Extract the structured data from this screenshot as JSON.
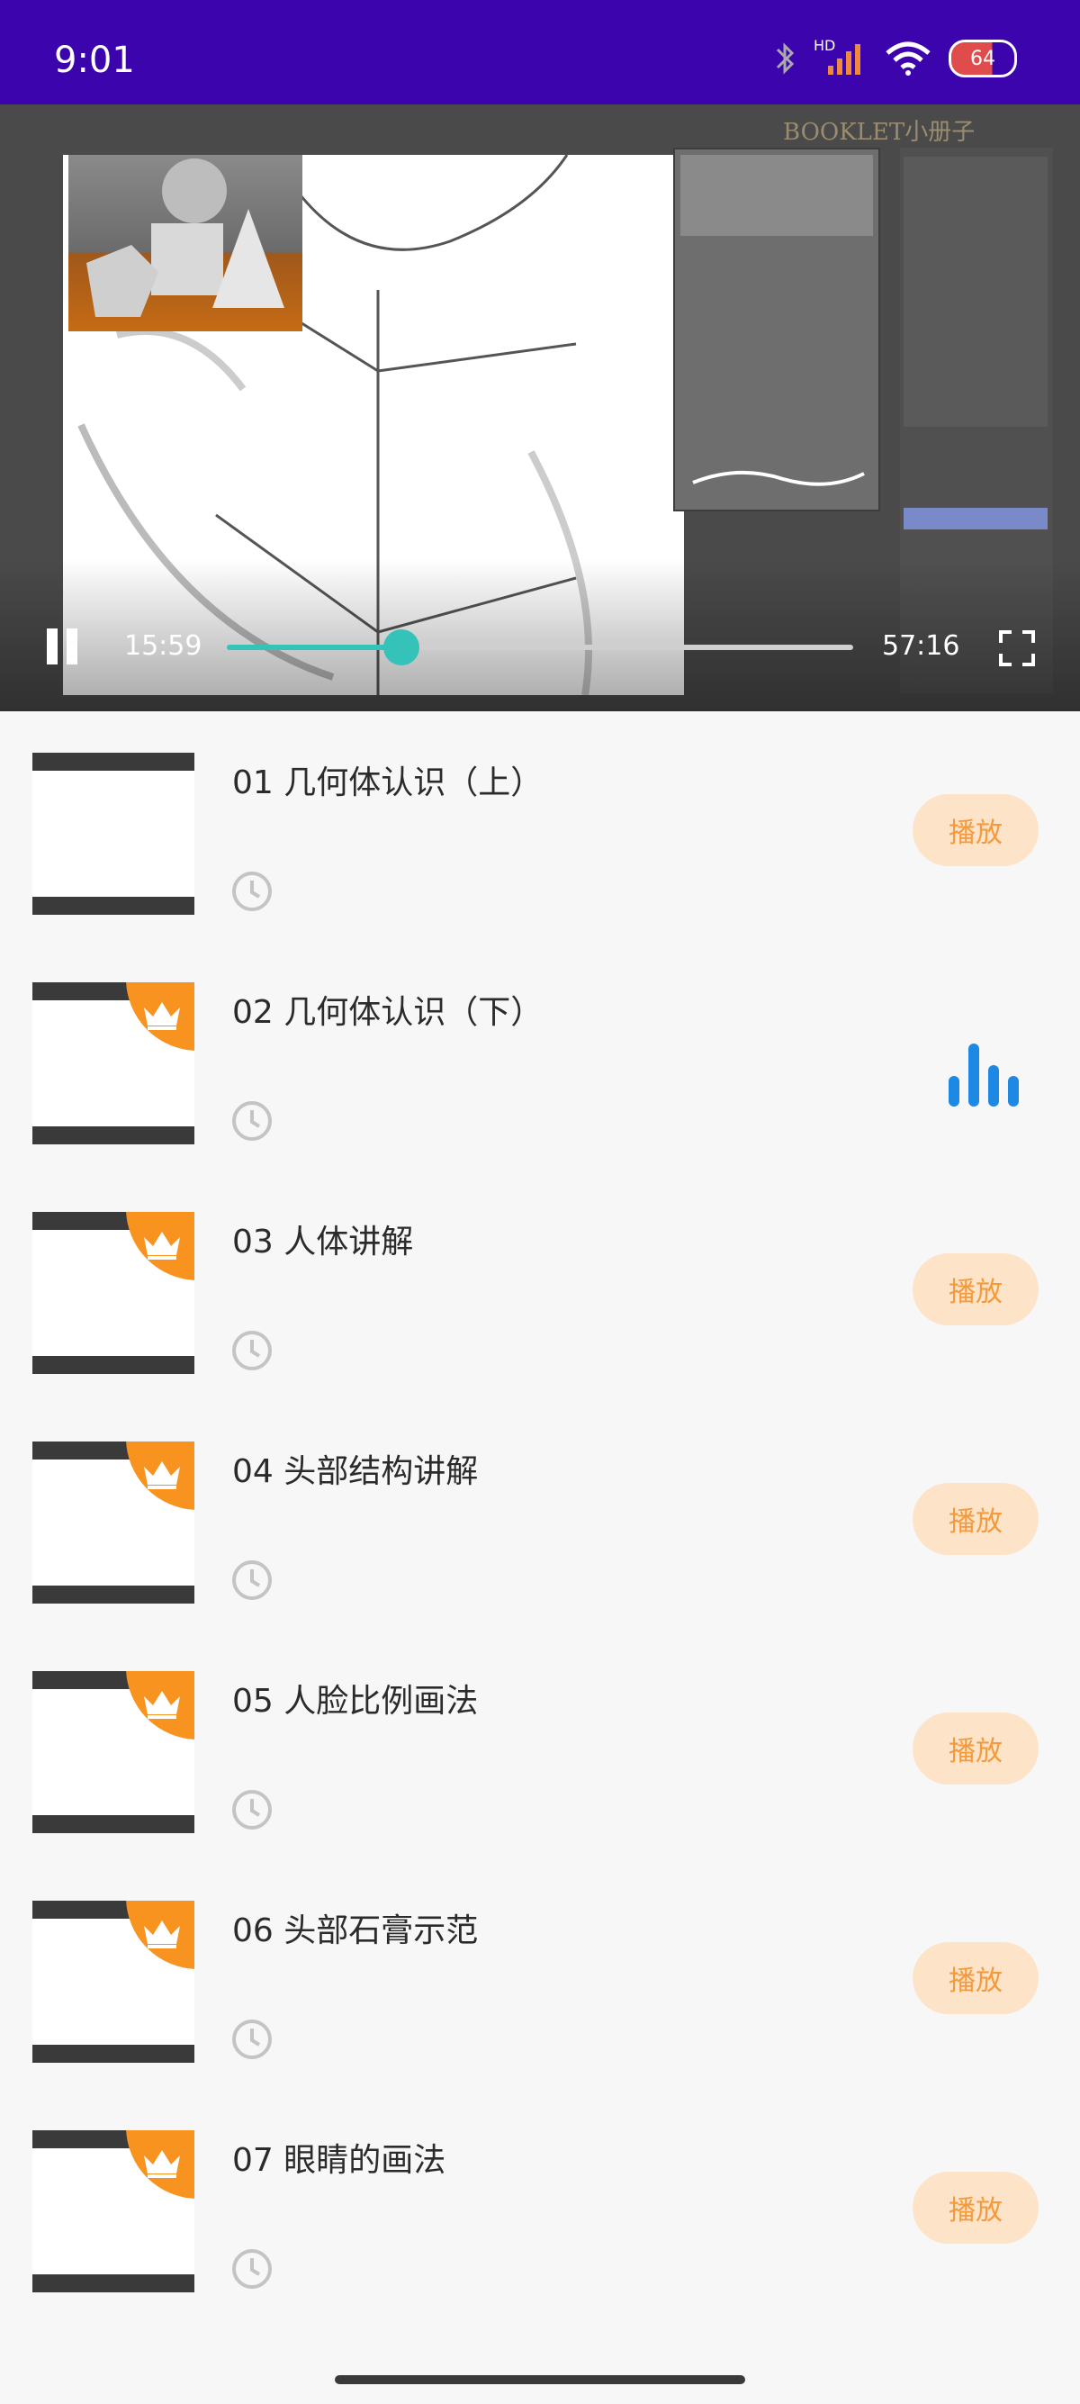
{
  "status_bar": {
    "time": "9:01",
    "network_badge": "HD",
    "battery_level": "64"
  },
  "video": {
    "watermark": "BOOKLET小册子",
    "current_time": "15:59",
    "duration": "57:16",
    "progress": 0.279
  },
  "lessons": [
    {
      "title": "01 几何体认识（上）",
      "play_label": "播放",
      "premium": false,
      "playing": false
    },
    {
      "title": "02 几何体认识（下）",
      "play_label": "",
      "premium": true,
      "playing": true
    },
    {
      "title": "03 人体讲解",
      "play_label": "播放",
      "premium": true,
      "playing": false
    },
    {
      "title": "04 头部结构讲解",
      "play_label": "播放",
      "premium": true,
      "playing": false
    },
    {
      "title": "05 人脸比例画法",
      "play_label": "播放",
      "premium": true,
      "playing": false
    },
    {
      "title": "06 头部石膏示范",
      "play_label": "播放",
      "premium": true,
      "playing": false
    },
    {
      "title": "07 眼睛的画法",
      "play_label": "播放",
      "premium": true,
      "playing": false
    }
  ],
  "colors": {
    "status_bar": "#3b04ad",
    "accent_teal": "#35c2b9",
    "play_button_bg": "#fde3c8",
    "play_button_text": "#f39a3d",
    "crown_badge": "#f7931e",
    "playing_icon": "#1e88e5"
  }
}
